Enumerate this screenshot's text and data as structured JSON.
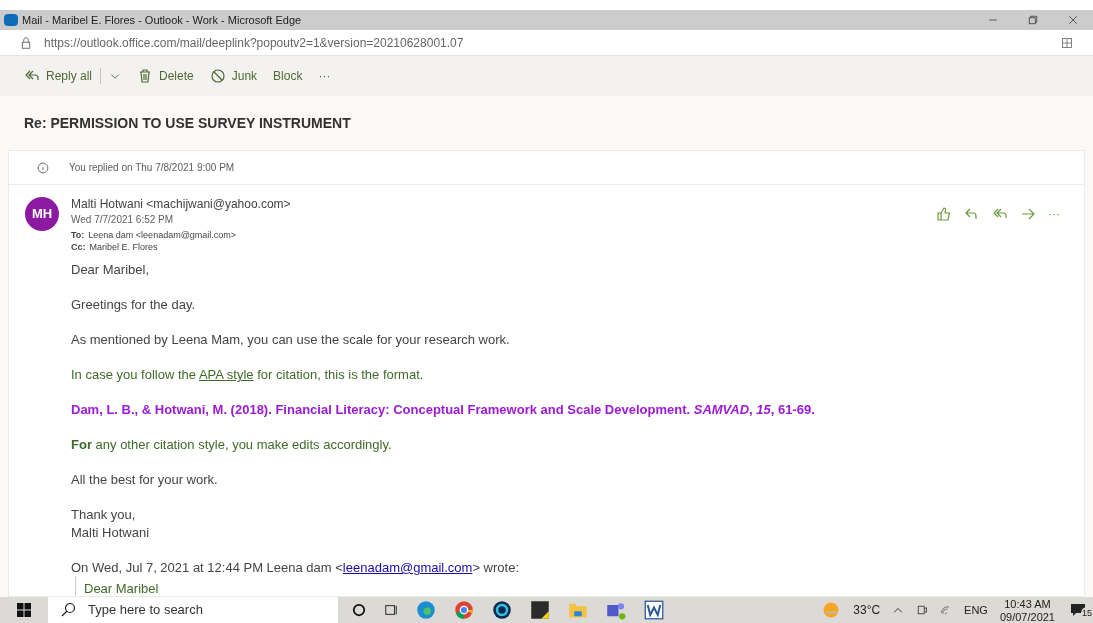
{
  "window": {
    "title": "Mail - Maribel E. Flores - Outlook - Work - Microsoft Edge",
    "controls": [
      {
        "kind": "minimize"
      },
      {
        "kind": "restore"
      },
      {
        "kind": "close"
      }
    ]
  },
  "address_bar": {
    "url_host": "https://outlook.office.com",
    "url_path": "/mail/deeplink?popoutv2=1&version=20210628001.07"
  },
  "toolbar": [
    {
      "kind": "reply-all",
      "label": "Reply all"
    },
    {
      "kind": "dropdown"
    },
    {
      "kind": "delete",
      "label": "Delete"
    },
    {
      "kind": "junk",
      "label": "Junk"
    },
    {
      "kind": "plain",
      "label": "Block"
    },
    {
      "kind": "more",
      "label": "···"
    }
  ],
  "subject": "Re: PERMISSION TO USE SURVEY INSTRUMENT",
  "notice": "You replied on Thu 7/8/2021 9:00 PM",
  "message": {
    "avatar": "MH",
    "from": "Malti Hotwani <machijwani@yahoo.com>",
    "date": "Wed 7/7/2021 6:52 PM",
    "to_label": "To:",
    "to": "Leena dam <leenadam@gmail.com>",
    "cc_label": "Cc:",
    "cc": "Maribel E. Flores",
    "actions": [
      {
        "kind": "like"
      },
      {
        "kind": "reply"
      },
      {
        "kind": "reply-all"
      },
      {
        "kind": "forward"
      },
      {
        "kind": "more",
        "label": "···"
      }
    ],
    "paragraphs": [
      {
        "kind": "plain",
        "lines": [
          "Dear Maribel,"
        ]
      },
      {
        "kind": "plain",
        "lines": [
          "Greetings for the day."
        ]
      },
      {
        "kind": "plain",
        "lines": [
          "As mentioned by Leena Mam, you can use the scale for your research work."
        ]
      },
      {
        "kind": "green",
        "before": "In case you follow the ",
        "link": "APA style",
        "after": " for citation, this is the format."
      },
      {
        "kind": "citation",
        "lines": [
          "Dam, L. B., & Hotwani, M. (2018). Financial Literacy: Conceptual Framework and Scale Development. *SAMVAD*, *15*, 61-69."
        ]
      },
      {
        "kind": "green",
        "lines": [
          "**For** any other citation style, you make edits accordingly."
        ]
      },
      {
        "kind": "plain",
        "lines": [
          "All the best for your work."
        ]
      },
      {
        "kind": "plain",
        "lines": [
          "Thank you,",
          "Malti Hotwani"
        ]
      },
      {
        "kind": "plain",
        "before": "On Wed, Jul 7, 2021 at 12:44 PM Leena dam <",
        "link": "leenadam@gmail.com",
        "after": "> wrote:"
      }
    ],
    "quote": "Dear Maribel"
  },
  "taskbar": {
    "search_placeholder": "Type here to search",
    "weather": "33°C",
    "language": "ENG",
    "time": "10:43 AM",
    "date": "09/07/2021",
    "notifications": "15"
  }
}
